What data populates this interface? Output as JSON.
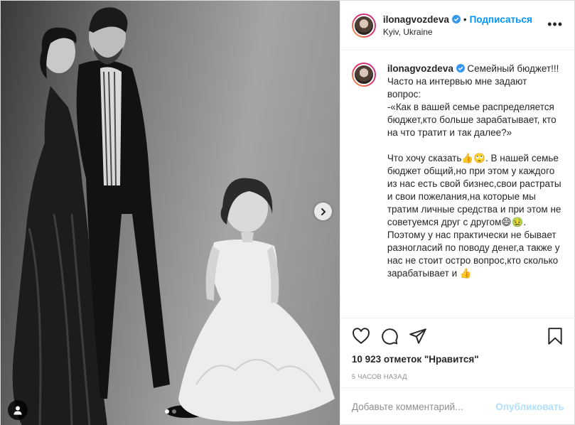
{
  "post": {
    "username": "ilonagvozdeva",
    "follow_label": "Подписаться",
    "location": "Kyiv, Ukraine",
    "more_label": "•••",
    "caption": "Семейный бюджет!!!\nЧасто на интервью мне задают вопрос:\n-«Как в вашей семье распределяется бюджет,кто больше зарабатывает, кто на что тратит и так далее?»\n\nЧто хочу сказать👍🙄. В нашей семье бюджет общий,но при этом у каждого из нас есть свой бизнес,свои растраты и свои пожелания,на которые мы тратим личные средства и при этом не советуемся друг с другом😄🤢.\nПоэтому у нас практически не бывает разногласий по поводу денег,а также у нас не стоит остро вопрос,кто сколько зарабатывает и 👍",
    "likes": "10 923 отметок \"Нравится\"",
    "time_ago": "5 часов назад",
    "comment_placeholder": "Добавьте комментарий...",
    "publish_label": "Опубликовать",
    "carousel": {
      "slides": 2,
      "current": 1
    },
    "icons": [
      "heart-icon",
      "comment-icon",
      "share-icon",
      "bookmark-icon",
      "verified-badge-icon",
      "chevron-right-icon",
      "user-tag-icon"
    ],
    "colors": {
      "link": "#0095f6",
      "publish_disabled": "#b2dffc",
      "secondary_text": "#8e8e8e",
      "verified": "#3897f0"
    }
  }
}
